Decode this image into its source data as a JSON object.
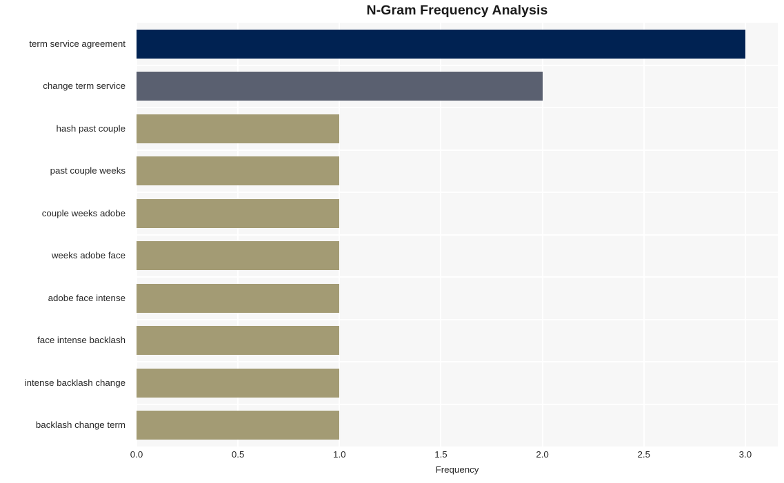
{
  "chart_data": {
    "type": "bar",
    "orientation": "horizontal",
    "title": "N-Gram Frequency Analysis",
    "xlabel": "Frequency",
    "ylabel": "",
    "categories": [
      "term service agreement",
      "change term service",
      "hash past couple",
      "past couple weeks",
      "couple weeks adobe",
      "weeks adobe face",
      "adobe face intense",
      "face intense backlash",
      "intense backlash change",
      "backlash change term"
    ],
    "values": [
      3,
      2,
      1,
      1,
      1,
      1,
      1,
      1,
      1,
      1
    ],
    "bar_colors": [
      "#002252",
      "#5a6070",
      "#a39b74",
      "#a39b74",
      "#a39b74",
      "#a39b74",
      "#a39b74",
      "#a39b74",
      "#a39b74",
      "#a39b74"
    ],
    "xlim": [
      0,
      3.16
    ],
    "x_ticks": [
      0,
      0.5,
      1,
      1.5,
      2,
      2.5,
      3
    ],
    "x_tick_labels": [
      "0.0",
      "0.5",
      "1.0",
      "1.5",
      "2.0",
      "2.5",
      "3.0"
    ],
    "grid": true,
    "grid_color": "#ffffff",
    "plot_background": "#f7f7f7",
    "legend": null
  },
  "style": {
    "title_color": "#1a1a1a",
    "tick_label_color": "#262626",
    "page_background": "#ffffff"
  }
}
